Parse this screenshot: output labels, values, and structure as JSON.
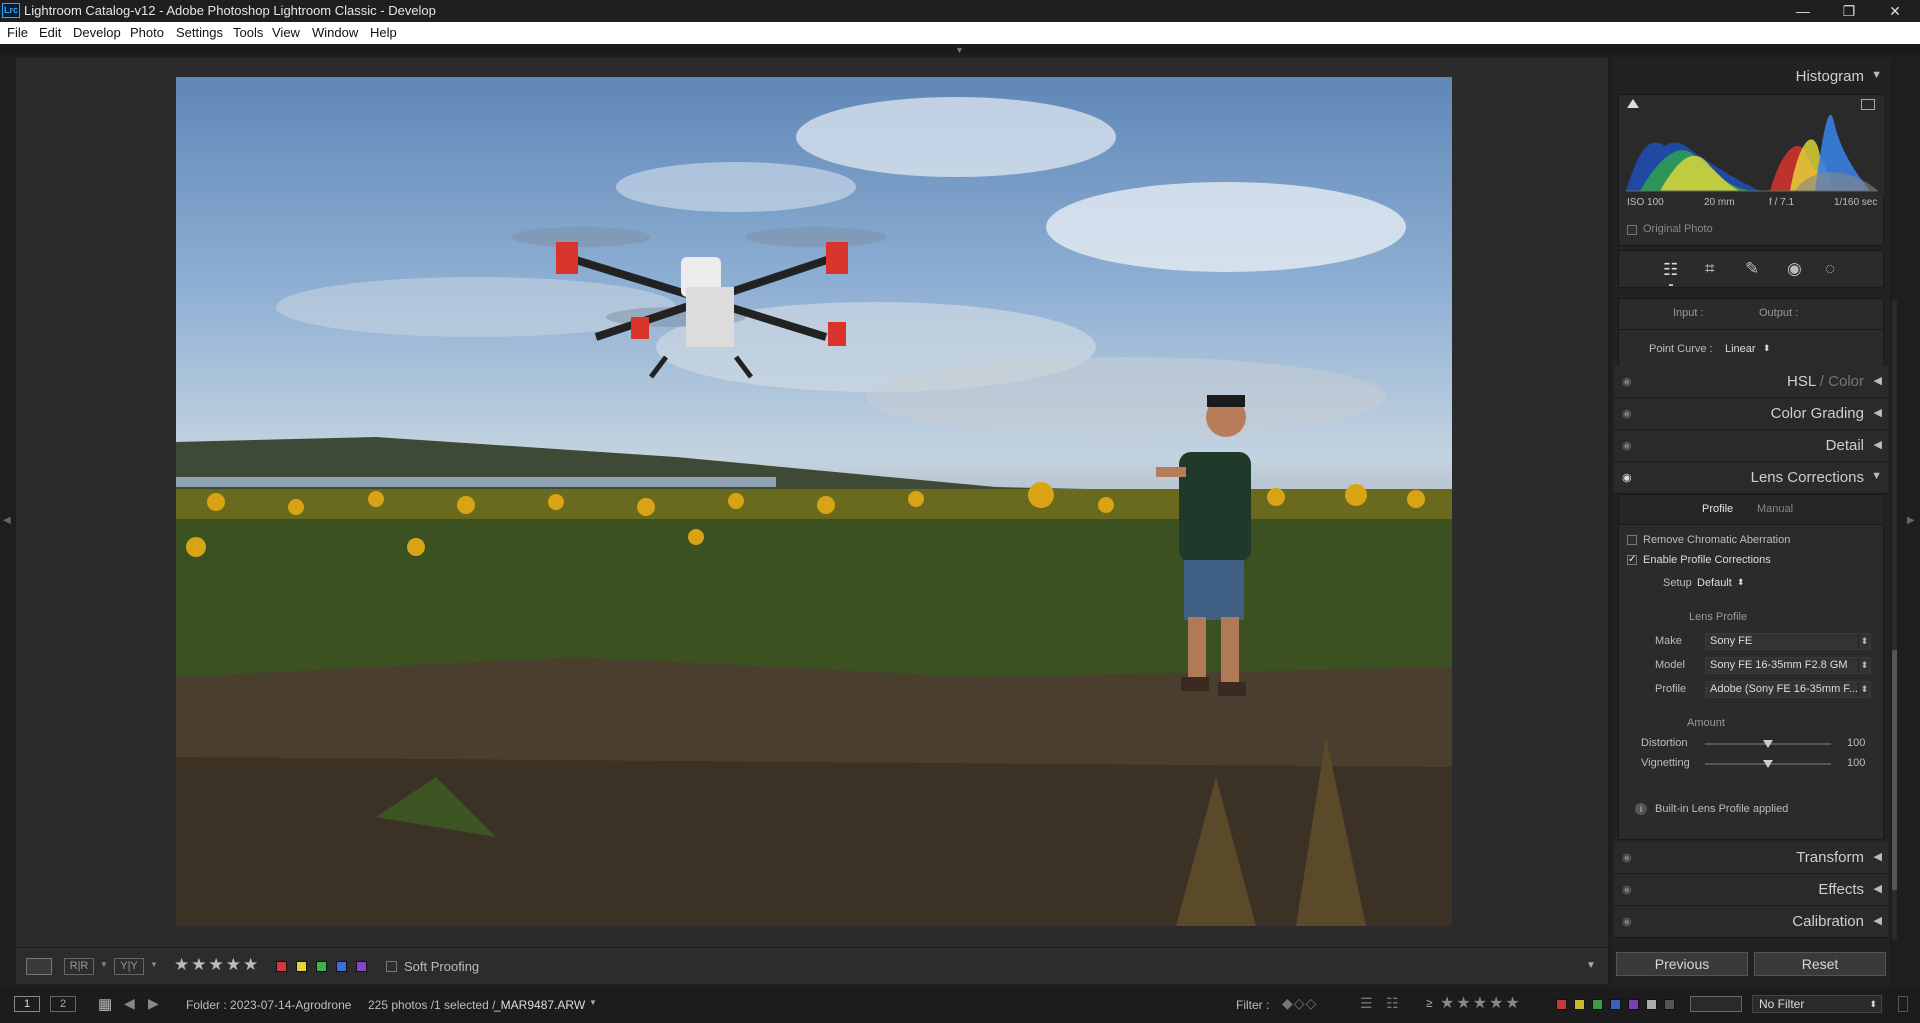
{
  "window": {
    "app_icon_text": "Lrc",
    "title": "Lightroom Catalog-v12 - Adobe Photoshop Lightroom Classic - Develop",
    "minimize": "—",
    "maximize": "❐",
    "close": "✕"
  },
  "menu": [
    "File",
    "Edit",
    "Develop",
    "Photo",
    "Settings",
    "Tools",
    "View",
    "Window",
    "Help"
  ],
  "histogram": {
    "title": "Histogram",
    "iso": "ISO 100",
    "focal": "20 mm",
    "aperture": "f / 7.1",
    "shutter": "1/160 sec",
    "original_photo": "Original Photo"
  },
  "tone_curve": {
    "input": "Input :",
    "output": "Output :",
    "point_curve_label": "Point Curve :",
    "point_curve_value": "Linear"
  },
  "panels": {
    "hsl_a": "HSL",
    "hsl_sep": " / ",
    "hsl_b": "Color",
    "color_grading": "Color Grading",
    "detail": "Detail",
    "lens_corrections": "Lens Corrections",
    "transform": "Transform",
    "effects": "Effects",
    "calibration": "Calibration"
  },
  "lens": {
    "tab_profile": "Profile",
    "tab_manual": "Manual",
    "remove_ca": "Remove Chromatic Aberration",
    "enable_profile": "Enable Profile Corrections",
    "enable_profile_checked": true,
    "setup_label": "Setup",
    "setup_value": "Default",
    "lens_profile_heading": "Lens Profile",
    "make_label": "Make",
    "make_value": "Sony FE",
    "model_label": "Model",
    "model_value": "Sony FE 16-35mm F2.8 GM",
    "profile_label": "Profile",
    "profile_value": "Adobe (Sony FE 16-35mm F...",
    "amount_heading": "Amount",
    "distortion_label": "Distortion",
    "distortion_value": "100",
    "vignetting_label": "Vignetting",
    "vignetting_value": "100",
    "info_text": "Built-in Lens Profile applied"
  },
  "buttons": {
    "previous": "Previous",
    "reset": "Reset"
  },
  "toolbar": {
    "stars": "★★★★★",
    "soft_proofing": "Soft Proofing",
    "color_labels": [
      "#d9383a",
      "#e6d23a",
      "#3ab54a",
      "#3a6fd9",
      "#8a44c9"
    ]
  },
  "filmstrip": {
    "monitor1": "1",
    "monitor2": "2",
    "folder": "Folder : 2023-07-14-Agrodrone",
    "count": "225 photos /1 selected /",
    "filename": "_MAR9487.ARW",
    "filter_label": "Filter :",
    "rating_op": "≥",
    "stars": "★★★★★",
    "no_filter": "No Filter"
  }
}
